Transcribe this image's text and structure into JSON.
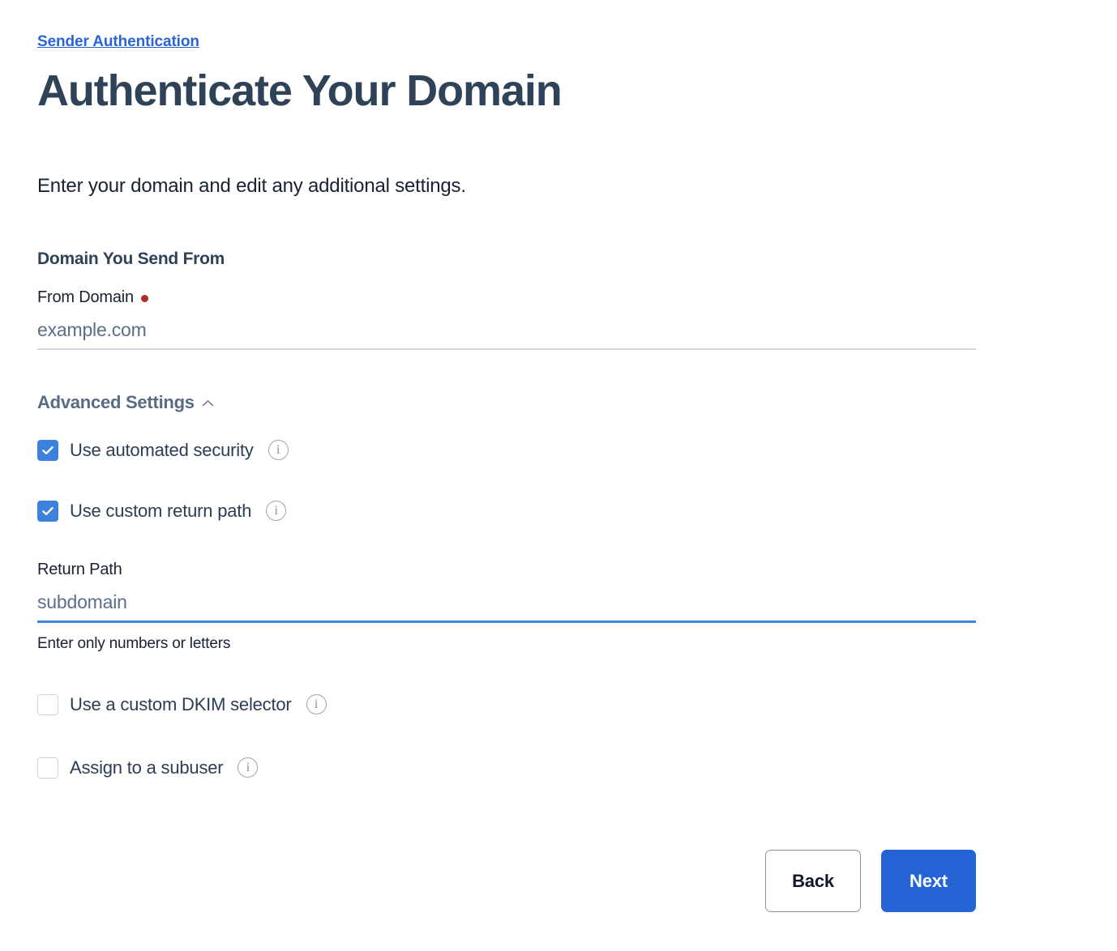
{
  "breadcrumb": {
    "label": "Sender Authentication"
  },
  "header": {
    "title": "Authenticate Your Domain",
    "intro": "Enter your domain and edit any additional settings."
  },
  "domain_section": {
    "heading": "Domain You Send From",
    "from_domain": {
      "label": "From Domain",
      "required": true,
      "value": "",
      "placeholder": "example.com"
    }
  },
  "advanced": {
    "label": "Advanced Settings",
    "expanded": true,
    "chevron_icon": "chevron-up-icon",
    "options": [
      {
        "id": "automated-security",
        "label": "Use automated security",
        "checked": true,
        "info_icon": "info-icon",
        "info_glyph": "i"
      },
      {
        "id": "custom-return-path",
        "label": "Use custom return path",
        "checked": true,
        "info_icon": "info-icon",
        "info_glyph": "i"
      },
      {
        "id": "custom-dkim-selector",
        "label": "Use a custom DKIM selector",
        "checked": false,
        "info_icon": "info-icon",
        "info_glyph": "i"
      },
      {
        "id": "assign-subuser",
        "label": "Assign to a subuser",
        "checked": false,
        "info_icon": "info-icon",
        "info_glyph": "i"
      }
    ],
    "return_path": {
      "label": "Return Path",
      "value": "",
      "placeholder": "subdomain",
      "helper": "Enter only numbers or letters",
      "focused": true
    }
  },
  "footer": {
    "back_label": "Back",
    "next_label": "Next"
  },
  "colors": {
    "link_blue": "#2a64d6",
    "title_slate": "#2e4258",
    "checkbox_blue": "#3b81dd",
    "primary_button_blue": "#2564d4",
    "focus_underline_blue": "#3e85e0",
    "idle_underline_gray": "#d2d7de",
    "required_red": "#ab2d23",
    "advanced_label_gray": "#586b83",
    "info_icon_gray": "#8592a3"
  }
}
